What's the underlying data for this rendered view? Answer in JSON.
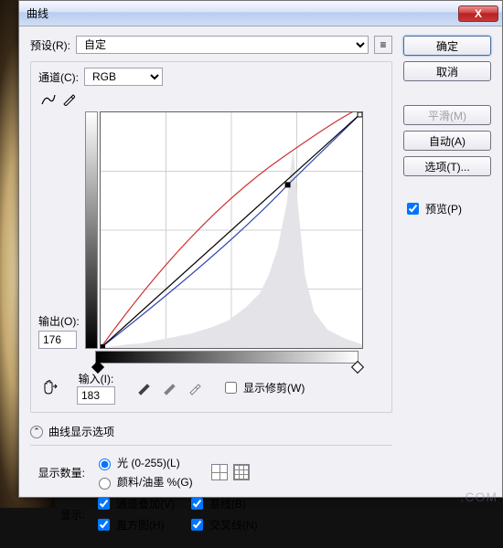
{
  "title": "曲线",
  "buttons": {
    "ok": "确定",
    "cancel": "取消",
    "smooth": "平滑(M)",
    "auto": "自动(A)",
    "options": "选项(T)..."
  },
  "preview": {
    "label": "预览(P)",
    "checked": true
  },
  "preset": {
    "label": "预设(R):",
    "value": "自定"
  },
  "channel": {
    "label": "通道(C):",
    "value": "RGB"
  },
  "output": {
    "label": "输出(O):",
    "value": "176"
  },
  "input": {
    "label": "输入(I):",
    "value": "183"
  },
  "show_clipping": {
    "label": "显示修剪(W)",
    "checked": false
  },
  "display_options_toggle": "曲线显示选项",
  "amount": {
    "label": "显示数量:",
    "light": "光 (0-255)(L)",
    "pigment": "颜料/油墨 %(G)",
    "selected": "light"
  },
  "show": {
    "label": "显示:",
    "overlay": "通道叠加(V)",
    "histogram": "直方图(H)",
    "baseline": "基线(B)",
    "intersection": "交叉线(N)"
  },
  "watermark": ".COM",
  "close_x": "X"
}
